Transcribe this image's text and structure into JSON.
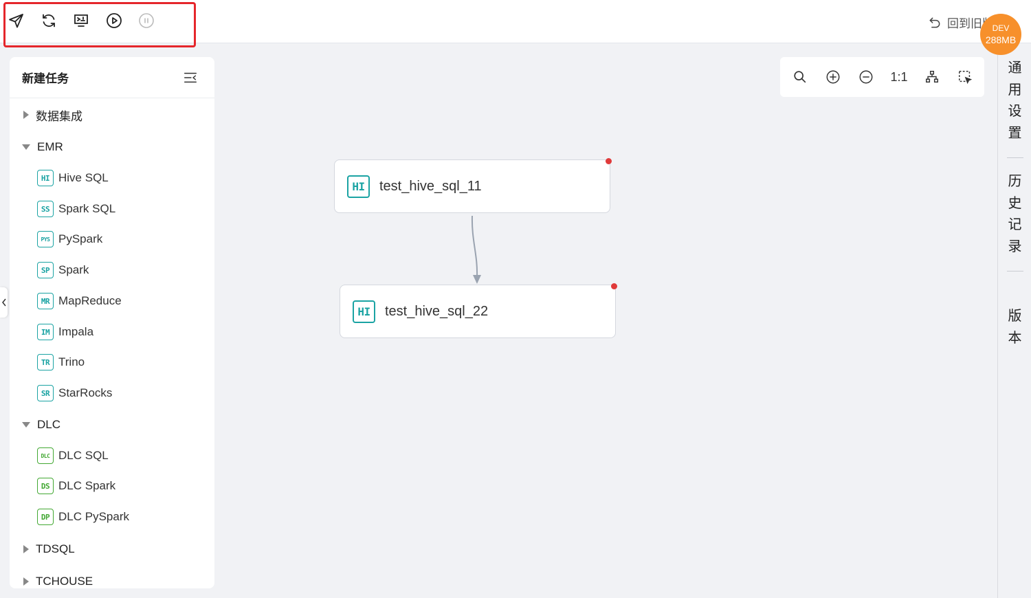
{
  "toolbar": {
    "buttons": [
      "submit",
      "refresh",
      "deploy",
      "run",
      "pause"
    ],
    "back_label": "回到旧版"
  },
  "env_badge": {
    "env": "DEV",
    "memory": "288MB"
  },
  "left_panel": {
    "title": "新建任务",
    "groups": [
      {
        "label": "数据集成",
        "expanded": false
      },
      {
        "label": "EMR",
        "expanded": true,
        "items": [
          {
            "badge": "HI",
            "label": "Hive SQL"
          },
          {
            "badge": "SS",
            "label": "Spark SQL"
          },
          {
            "badge": "PYS",
            "label": "PySpark"
          },
          {
            "badge": "SP",
            "label": "Spark"
          },
          {
            "badge": "MR",
            "label": "MapReduce"
          },
          {
            "badge": "IM",
            "label": "Impala"
          },
          {
            "badge": "TR",
            "label": "Trino"
          },
          {
            "badge": "SR",
            "label": "StarRocks"
          }
        ]
      },
      {
        "label": "DLC",
        "expanded": true,
        "items": [
          {
            "badge": "DLC",
            "label": "DLC SQL"
          },
          {
            "badge": "DS",
            "label": "DLC Spark"
          },
          {
            "badge": "DP",
            "label": "DLC PySpark"
          }
        ]
      },
      {
        "label": "TDSQL",
        "expanded": false
      },
      {
        "label": "TCHOUSE",
        "expanded": false
      }
    ]
  },
  "canvas_tools": {
    "ratio_label": "1:1"
  },
  "nodes": [
    {
      "badge": "HI",
      "label": "test_hive_sql_11"
    },
    {
      "badge": "HI",
      "label": "test_hive_sql_22"
    }
  ],
  "right_bar": {
    "general_settings": [
      "通",
      "用",
      "设",
      "置"
    ],
    "history": [
      "历",
      "史",
      "记",
      "录"
    ],
    "version": [
      "版",
      "本"
    ]
  },
  "colors": {
    "accent_teal": "#1aa3a3",
    "accent_green": "#42a832",
    "highlight_red": "#e5262b",
    "badge_orange": "#f7902b",
    "status_dot": "#e03a3a"
  }
}
